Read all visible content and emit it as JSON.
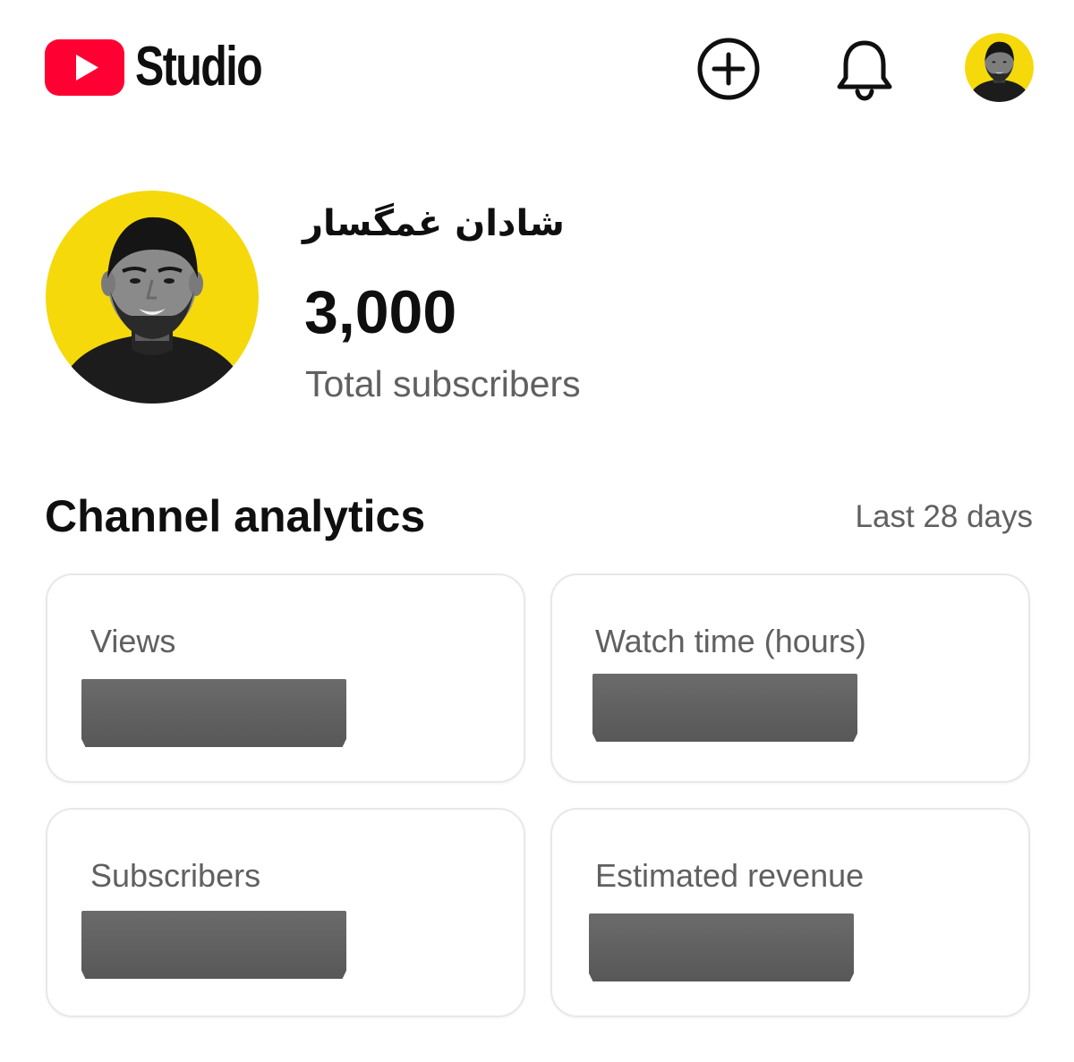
{
  "header": {
    "logo_text": "Studio",
    "brand_color": "#ff0000",
    "icons": [
      "youtube-logo-icon",
      "create-plus-icon",
      "bell-icon",
      "account-avatar"
    ]
  },
  "profile": {
    "channel_name": "شادان غمگسار",
    "subscriber_count": "3,000",
    "subscriber_label": "Total subscribers",
    "avatar_bg_color": "#f5d90a"
  },
  "analytics": {
    "title": "Channel analytics",
    "period": "Last 28 days",
    "cards": [
      {
        "label": "Views",
        "value_redacted": true
      },
      {
        "label": "Watch time (hours)",
        "value_redacted": true
      },
      {
        "label": "Subscribers",
        "value_redacted": true
      },
      {
        "label": "Estimated revenue",
        "value_redacted": true
      }
    ]
  }
}
